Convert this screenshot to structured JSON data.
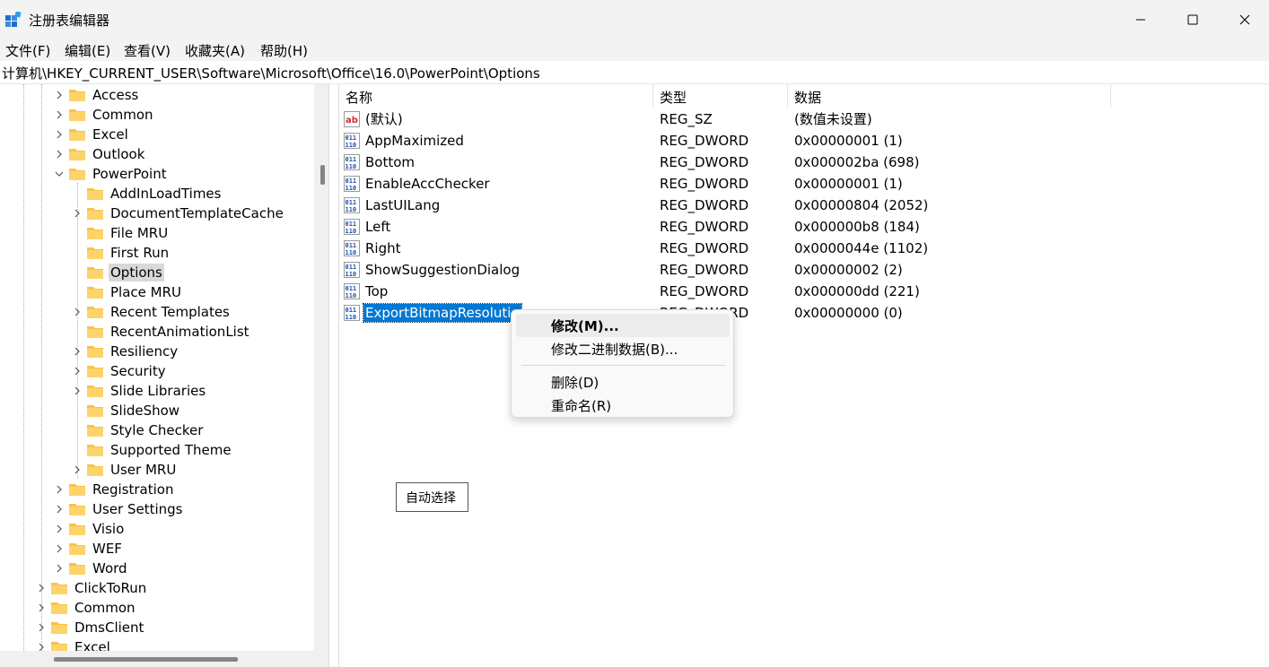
{
  "window": {
    "title": "注册表编辑器",
    "icon": "regedit-icon"
  },
  "menu": [
    "文件(F)",
    "编辑(E)",
    "查看(V)",
    "收藏夹(A)",
    "帮助(H)"
  ],
  "address": "计算机\\HKEY_CURRENT_USER\\Software\\Microsoft\\Office\\16.0\\PowerPoint\\Options",
  "tree": [
    {
      "label": "Access",
      "level": 2,
      "chev": "right"
    },
    {
      "label": "Common",
      "level": 2,
      "chev": "right"
    },
    {
      "label": "Excel",
      "level": 2,
      "chev": "right"
    },
    {
      "label": "Outlook",
      "level": 2,
      "chev": "right"
    },
    {
      "label": "PowerPoint",
      "level": 2,
      "chev": "down"
    },
    {
      "label": "AddInLoadTimes",
      "level": 3,
      "chev": "none"
    },
    {
      "label": "DocumentTemplateCache",
      "level": 3,
      "chev": "right"
    },
    {
      "label": "File MRU",
      "level": 3,
      "chev": "none"
    },
    {
      "label": "First Run",
      "level": 3,
      "chev": "none"
    },
    {
      "label": "Options",
      "level": 3,
      "chev": "none",
      "selected": true
    },
    {
      "label": "Place MRU",
      "level": 3,
      "chev": "none"
    },
    {
      "label": "Recent Templates",
      "level": 3,
      "chev": "right"
    },
    {
      "label": "RecentAnimationList",
      "level": 3,
      "chev": "none"
    },
    {
      "label": "Resiliency",
      "level": 3,
      "chev": "right"
    },
    {
      "label": "Security",
      "level": 3,
      "chev": "right"
    },
    {
      "label": "Slide Libraries",
      "level": 3,
      "chev": "right"
    },
    {
      "label": "SlideShow",
      "level": 3,
      "chev": "none"
    },
    {
      "label": "Style Checker",
      "level": 3,
      "chev": "none"
    },
    {
      "label": "Supported Theme",
      "level": 3,
      "chev": "none"
    },
    {
      "label": "User MRU",
      "level": 3,
      "chev": "right"
    },
    {
      "label": "Registration",
      "level": 2,
      "chev": "right"
    },
    {
      "label": "User Settings",
      "level": 2,
      "chev": "right"
    },
    {
      "label": "Visio",
      "level": 2,
      "chev": "right"
    },
    {
      "label": "WEF",
      "level": 2,
      "chev": "right"
    },
    {
      "label": "Word",
      "level": 2,
      "chev": "right"
    },
    {
      "label": "ClickToRun",
      "level": 1,
      "chev": "right"
    },
    {
      "label": "Common",
      "level": 1,
      "chev": "right"
    },
    {
      "label": "DmsClient",
      "level": 1,
      "chev": "right"
    },
    {
      "label": "Excel",
      "level": 1,
      "chev": "right"
    }
  ],
  "columns": {
    "name": "名称",
    "type": "类型",
    "data": "数据"
  },
  "values": [
    {
      "icon": "string",
      "name": "(默认)",
      "type": "REG_SZ",
      "data": "(数值未设置)"
    },
    {
      "icon": "binary",
      "name": "AppMaximized",
      "type": "REG_DWORD",
      "data": "0x00000001 (1)"
    },
    {
      "icon": "binary",
      "name": "Bottom",
      "type": "REG_DWORD",
      "data": "0x000002ba (698)"
    },
    {
      "icon": "binary",
      "name": "EnableAccChecker",
      "type": "REG_DWORD",
      "data": "0x00000001 (1)"
    },
    {
      "icon": "binary",
      "name": "LastUILang",
      "type": "REG_DWORD",
      "data": "0x00000804 (2052)"
    },
    {
      "icon": "binary",
      "name": "Left",
      "type": "REG_DWORD",
      "data": "0x000000b8 (184)"
    },
    {
      "icon": "binary",
      "name": "Right",
      "type": "REG_DWORD",
      "data": "0x0000044e (1102)"
    },
    {
      "icon": "binary",
      "name": "ShowSuggestionDialog",
      "type": "REG_DWORD",
      "data": "0x00000002 (2)"
    },
    {
      "icon": "binary",
      "name": "Top",
      "type": "REG_DWORD",
      "data": "0x000000dd (221)"
    },
    {
      "icon": "binary",
      "name": "ExportBitmapResolutio",
      "type": "REG_DWORD",
      "data": "0x00000000 (0)",
      "selected": true
    }
  ],
  "context_menu": {
    "items": [
      {
        "label": "修改(M)...",
        "hover": true
      },
      {
        "label": "修改二进制数据(B)..."
      },
      {
        "label": "删除(D)"
      },
      {
        "label": "重命名(R)"
      }
    ]
  },
  "tooltip": "自动选择",
  "colors": {
    "selection": "#0078d4",
    "folder": "#f8c24a",
    "icon_blue": "#1f4fa8",
    "icon_red": "#c8312f"
  }
}
